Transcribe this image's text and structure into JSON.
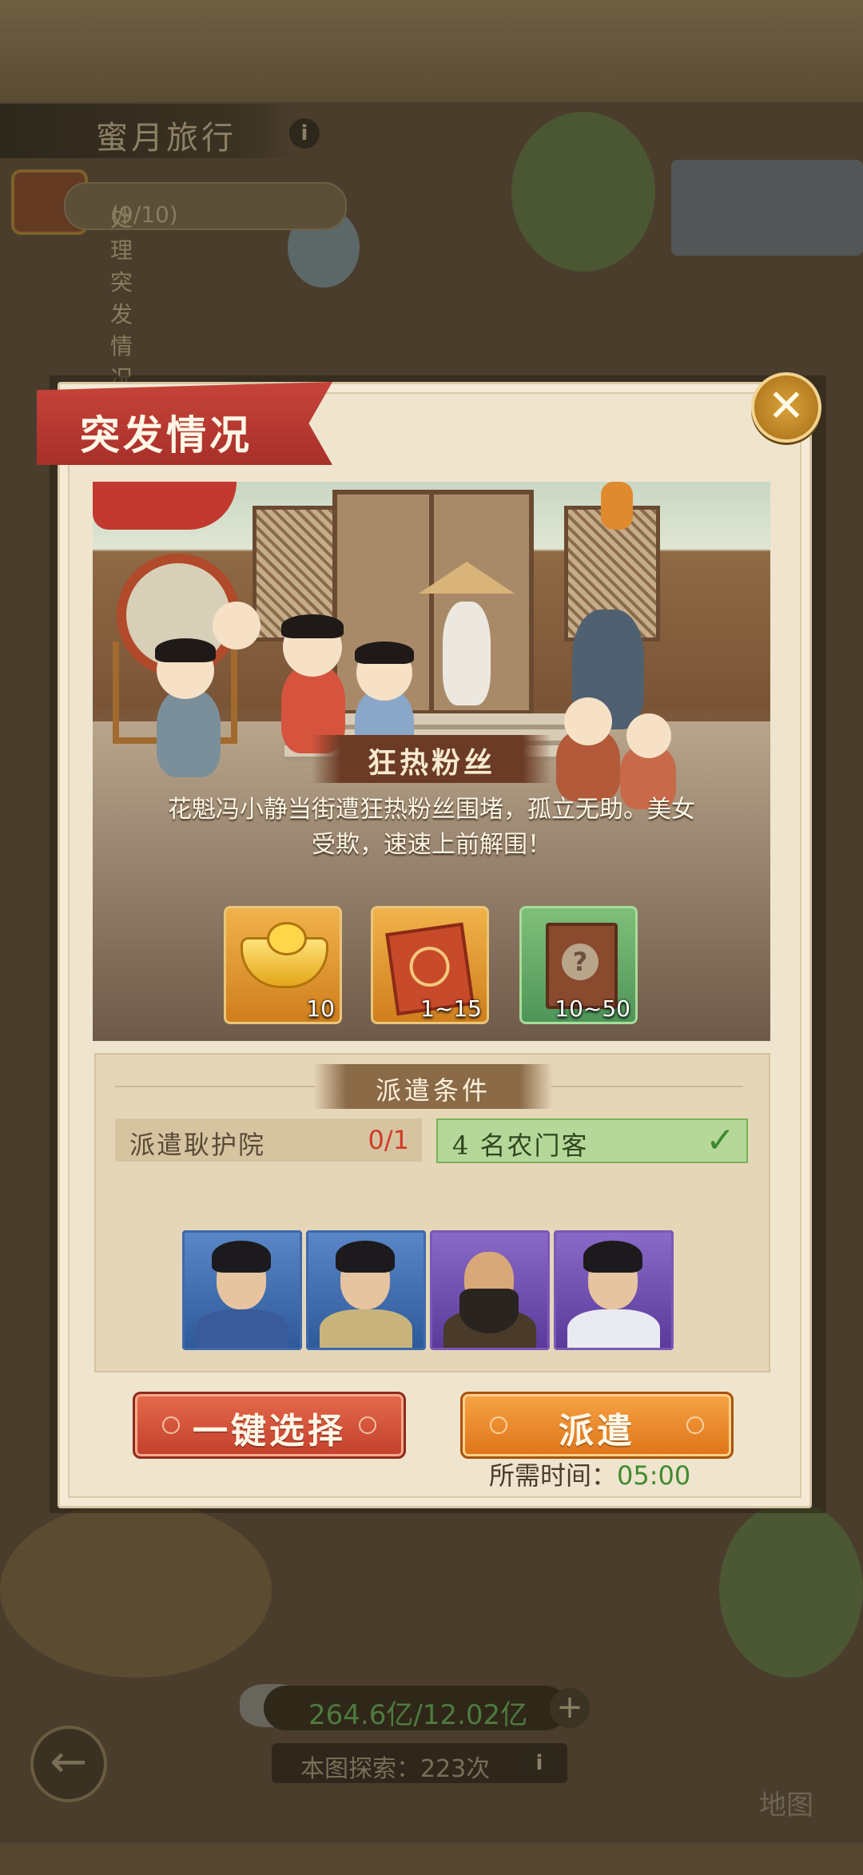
{
  "header": {
    "title": "蜜月旅行",
    "info_icon": "info-icon"
  },
  "task": {
    "label": "处理突发情况",
    "progress": "(9/10)"
  },
  "dialog": {
    "title": "突发情况",
    "close_icon": "close-icon",
    "event_name": "狂热粉丝",
    "event_desc_line1": "花魁冯小静当街遭狂热粉丝围堵，孤立无助。美女",
    "event_desc_line2": "受欺，速速上前解围！",
    "rewards": [
      {
        "icon": "gold-ingot-icon",
        "count": "10"
      },
      {
        "icon": "scroll-icon",
        "count": "1~15"
      },
      {
        "icon": "mystery-book-icon",
        "count": "10~50"
      }
    ],
    "conditions_title": "派遣条件",
    "condition1": {
      "label": "派遣耿护院",
      "count": "0/1"
    },
    "condition2": {
      "label": "4 名农门客",
      "status": "met"
    },
    "heroes": [
      {
        "name": "hero-portrait-1",
        "rarity": "blue"
      },
      {
        "name": "hero-portrait-2",
        "rarity": "blue"
      },
      {
        "name": "hero-portrait-3",
        "rarity": "purple"
      },
      {
        "name": "hero-portrait-4",
        "rarity": "purple"
      }
    ],
    "auto_select_label": "一键选择",
    "dispatch_label": "派遣",
    "time_label": "所需时间：",
    "time_value": "05:00"
  },
  "footer": {
    "resource": "264.6亿/12.02亿",
    "explore": "本图探索：223次",
    "map_label": "地图"
  },
  "colors": {
    "ribbon": "#c6443a",
    "dispatch": "#f6a446",
    "auto_select": "#e56a4c",
    "met_green": "#b5d89a"
  }
}
